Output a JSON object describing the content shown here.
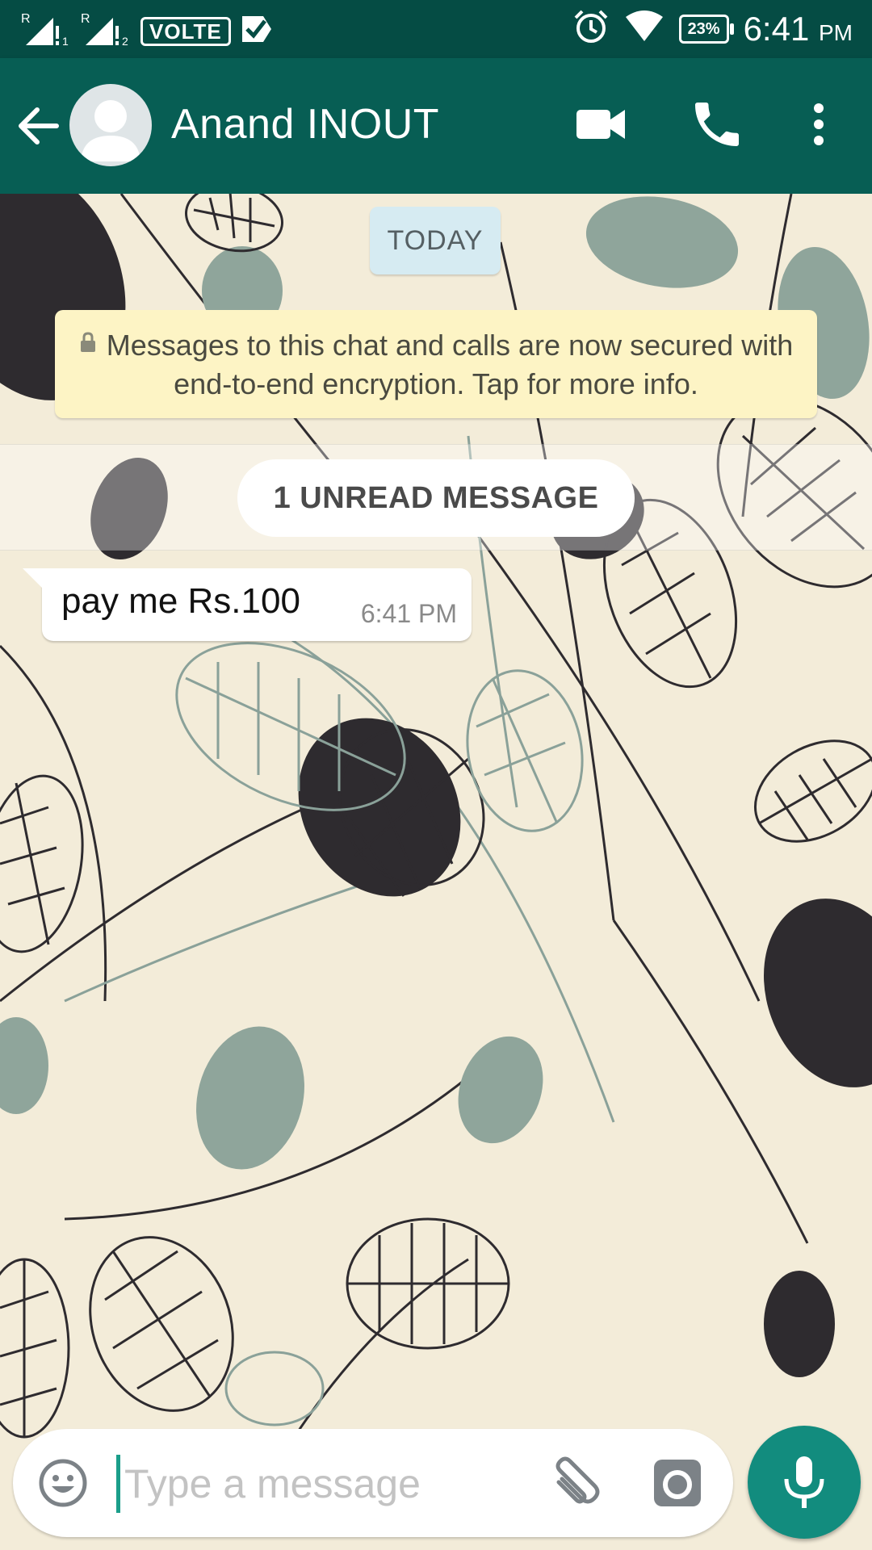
{
  "colors": {
    "status_bar": "#054c44",
    "app_bar": "#075e54",
    "mic_button": "#128c7e",
    "encryption_banner": "#fdf4c5",
    "date_chip": "#d6ebf2"
  },
  "status_bar": {
    "sim1_label": "R",
    "sim1_slot": "1",
    "sim2_label": "R",
    "sim2_slot": "2",
    "volte": "VOLTE",
    "battery": "23%",
    "time": "6:41",
    "ampm": "PM",
    "icons": [
      "signal-icon",
      "signal-icon",
      "check-icon",
      "alarm-icon",
      "wifi-icon",
      "battery-icon"
    ]
  },
  "header": {
    "contact_name": "Anand INOUT",
    "icons": [
      "back-arrow-icon",
      "avatar-placeholder-icon",
      "video-call-icon",
      "phone-icon",
      "more-vert-icon"
    ]
  },
  "chat": {
    "date_chip": "TODAY",
    "encryption_text": "Messages to this chat and calls are now secured with end-to-end encryption. Tap for more info.",
    "unread_label": "1 UNREAD MESSAGE",
    "messages": [
      {
        "text": "pay me Rs.100",
        "time": "6:41 PM",
        "direction": "incoming"
      }
    ]
  },
  "composer": {
    "placeholder": "Type a message",
    "value": "",
    "icons": [
      "emoji-icon",
      "attach-icon",
      "camera-icon",
      "mic-icon"
    ]
  }
}
